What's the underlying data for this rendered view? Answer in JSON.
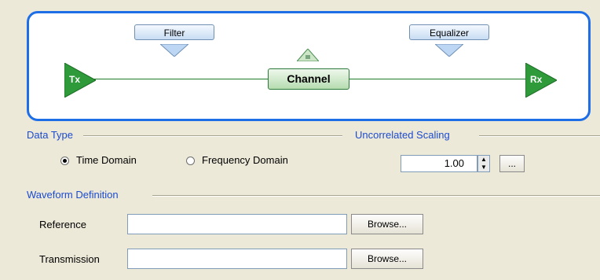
{
  "diagram": {
    "tx_label": "Tx",
    "rx_label": "Rx",
    "filter_label": "Filter",
    "equalizer_label": "Equalizer",
    "channel_label": "Channel"
  },
  "data_type": {
    "group_label": "Data Type",
    "options": [
      "Time Domain",
      "Frequency Domain"
    ],
    "selected": "Time Domain"
  },
  "scaling": {
    "group_label": "Uncorrelated Scaling",
    "value": "1.00",
    "ellipsis_button": "..."
  },
  "waveform": {
    "group_label": "Waveform Definition",
    "reference_label": "Reference",
    "reference_value": "",
    "transmission_label": "Transmission",
    "transmission_value": "",
    "browse_label": "Browse..."
  }
}
